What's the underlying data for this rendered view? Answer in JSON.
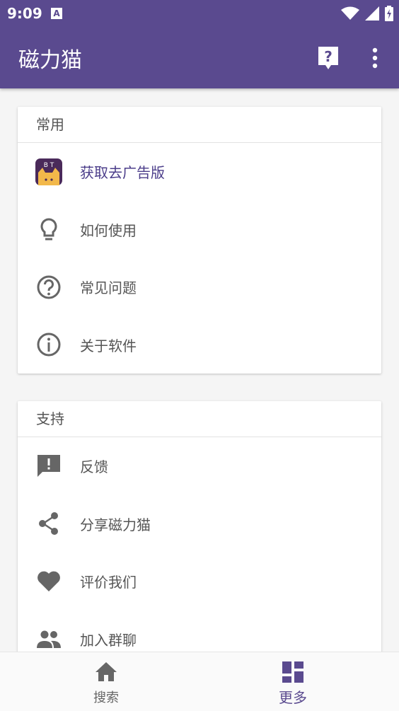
{
  "status_bar": {
    "time": "9:09",
    "notif_letter": "A"
  },
  "app_bar": {
    "title": "磁力猫",
    "help_icon": "help-chat-icon",
    "more_icon": "more-vert-icon"
  },
  "sections": [
    {
      "header": "常用",
      "items": [
        {
          "label": "获取去广告版",
          "icon": "app-logo-cat-icon",
          "bt_text": "B T",
          "accent": "#4b3d8a"
        },
        {
          "label": "如何使用",
          "icon": "lightbulb-icon"
        },
        {
          "label": "常见问题",
          "icon": "help-circle-icon"
        },
        {
          "label": "关于软件",
          "icon": "info-icon"
        }
      ]
    },
    {
      "header": "支持",
      "items": [
        {
          "label": "反馈",
          "icon": "feedback-icon"
        },
        {
          "label": "分享磁力猫",
          "icon": "share-icon"
        },
        {
          "label": "评价我们",
          "icon": "heart-icon"
        },
        {
          "label": "加入群聊",
          "icon": "group-icon"
        }
      ]
    }
  ],
  "bottom_nav": {
    "tabs": [
      {
        "label": "搜索",
        "icon": "home-icon",
        "active": false
      },
      {
        "label": "更多",
        "icon": "dashboard-icon",
        "active": true
      }
    ]
  },
  "colors": {
    "primary": "#5a4a8f",
    "accent_text": "#4b3d8a",
    "background": "#f5f5f5"
  }
}
